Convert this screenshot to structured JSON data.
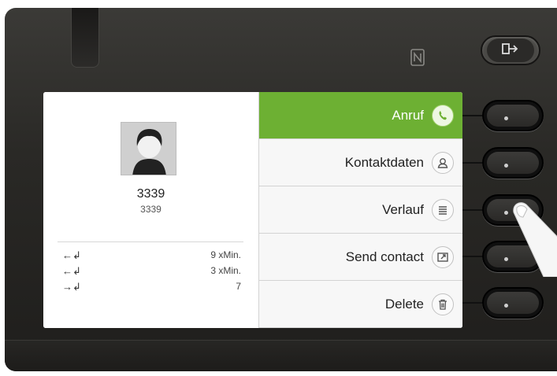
{
  "contact": {
    "name": "3339",
    "number": "3339"
  },
  "history": [
    {
      "direction": "incoming",
      "arrow": "←↲",
      "value": "9 xMin."
    },
    {
      "direction": "incoming",
      "arrow": "←↲",
      "value": "3 xMin."
    },
    {
      "direction": "outgoing",
      "arrow": "→↲",
      "value": "7"
    }
  ],
  "menu": {
    "items": [
      {
        "label": "Anruf",
        "icon": "phone-icon",
        "selected": true
      },
      {
        "label": "Kontaktdaten",
        "icon": "contact-icon",
        "selected": false
      },
      {
        "label": "Verlauf",
        "icon": "list-icon",
        "selected": false
      },
      {
        "label": "Send contact",
        "icon": "send-contact-icon",
        "selected": false
      },
      {
        "label": "Delete",
        "icon": "trash-icon",
        "selected": false
      }
    ]
  },
  "colors": {
    "accent": "#6db033",
    "device": "#2a2926"
  }
}
